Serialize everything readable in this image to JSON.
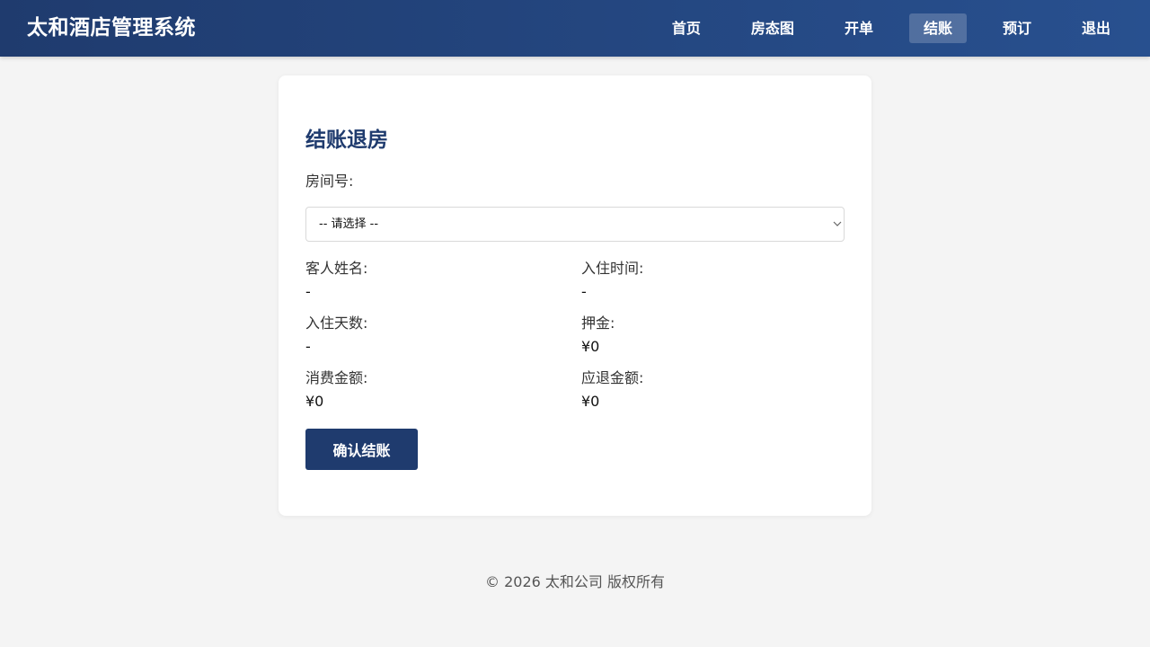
{
  "header": {
    "title": "太和酒店管理系统",
    "nav": [
      {
        "label": "首页",
        "active": false
      },
      {
        "label": "房态图",
        "active": false
      },
      {
        "label": "开单",
        "active": false
      },
      {
        "label": "结账",
        "active": true
      },
      {
        "label": "预订",
        "active": false
      },
      {
        "label": "退出",
        "active": false
      }
    ]
  },
  "checkout": {
    "title": "结账退房",
    "room_label": "房间号:",
    "room_select": {
      "selected": "-- 请选择 --"
    },
    "fields": {
      "guest_name": {
        "label": "客人姓名:",
        "value": "-"
      },
      "checkin_time": {
        "label": "入住时间:",
        "value": "-"
      },
      "days": {
        "label": "入住天数:",
        "value": "-"
      },
      "deposit": {
        "label": "押金:",
        "value": "¥0"
      },
      "consumption": {
        "label": "消费金额:",
        "value": "¥0"
      },
      "refund": {
        "label": "应退金额:",
        "value": "¥0"
      }
    },
    "confirm_label": "确认结账"
  },
  "footer": {
    "text": "© 2026 太和公司 版权所有"
  },
  "colors": {
    "primary": "#1f3b6e",
    "primary_light": "#28508f",
    "background": "#f4f4f4"
  }
}
